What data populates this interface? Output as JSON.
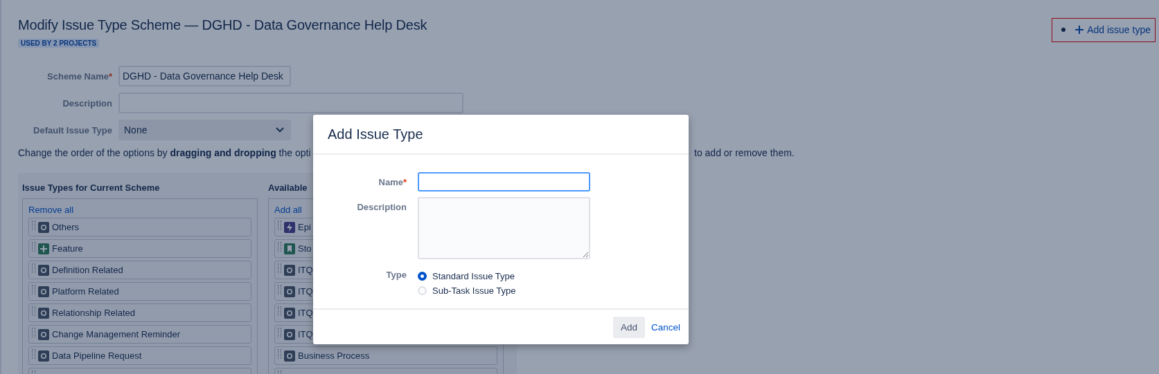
{
  "page": {
    "title": "Modify Issue Type Scheme — DGHD - Data Governance Help Desk",
    "badge": "USED BY 2 PROJECTS",
    "add_link": "Add issue type",
    "form": [
      {
        "label": "Scheme Name",
        "required_mark": "*",
        "kind": "input",
        "value": "DGHD - Data Governance Help Desk"
      },
      {
        "label": "Description",
        "kind": "wide"
      },
      {
        "label": "Default Issue Type",
        "kind": "select",
        "value": "None"
      }
    ],
    "instruction": {
      "start": "Change the order of the options by **dragging and dropping** the opti",
      "end": "to add or remove them."
    },
    "columns": [
      {
        "heading": "Issue Types for Current Scheme",
        "action": "Remove all",
        "items": [
          {
            "label": "Others",
            "kind": "other"
          },
          {
            "label": "Feature",
            "kind": "feature"
          },
          {
            "label": "Definition Related",
            "kind": "other"
          },
          {
            "label": "Platform Related",
            "kind": "other"
          },
          {
            "label": "Relationship Related",
            "kind": "other"
          },
          {
            "label": "Change Management Reminder",
            "kind": "other"
          },
          {
            "label": "Data Pipeline Request",
            "kind": "other"
          }
        ]
      },
      {
        "heading": "Available",
        "action": "Add all",
        "items": [
          {
            "label": "Epi",
            "kind": "epic"
          },
          {
            "label": "Sto",
            "kind": "story"
          },
          {
            "label": "ITQ",
            "kind": "other"
          },
          {
            "label": "ITQ",
            "kind": "other"
          },
          {
            "label": "ITQ",
            "kind": "other"
          },
          {
            "label": "ITQ",
            "kind": "other"
          },
          {
            "label": "Business Process",
            "kind": "other"
          }
        ]
      }
    ]
  },
  "dialog": {
    "title": "Add Issue Type",
    "name_label": "Name",
    "name_required_mark": "*",
    "description_label": "Description",
    "type_label": "Type",
    "type_options": [
      {
        "label": "Standard Issue Type",
        "selected": true
      },
      {
        "label": "Sub-Task Issue Type",
        "selected": false
      }
    ],
    "buttons": {
      "add": "Add",
      "cancel": "Cancel"
    }
  }
}
